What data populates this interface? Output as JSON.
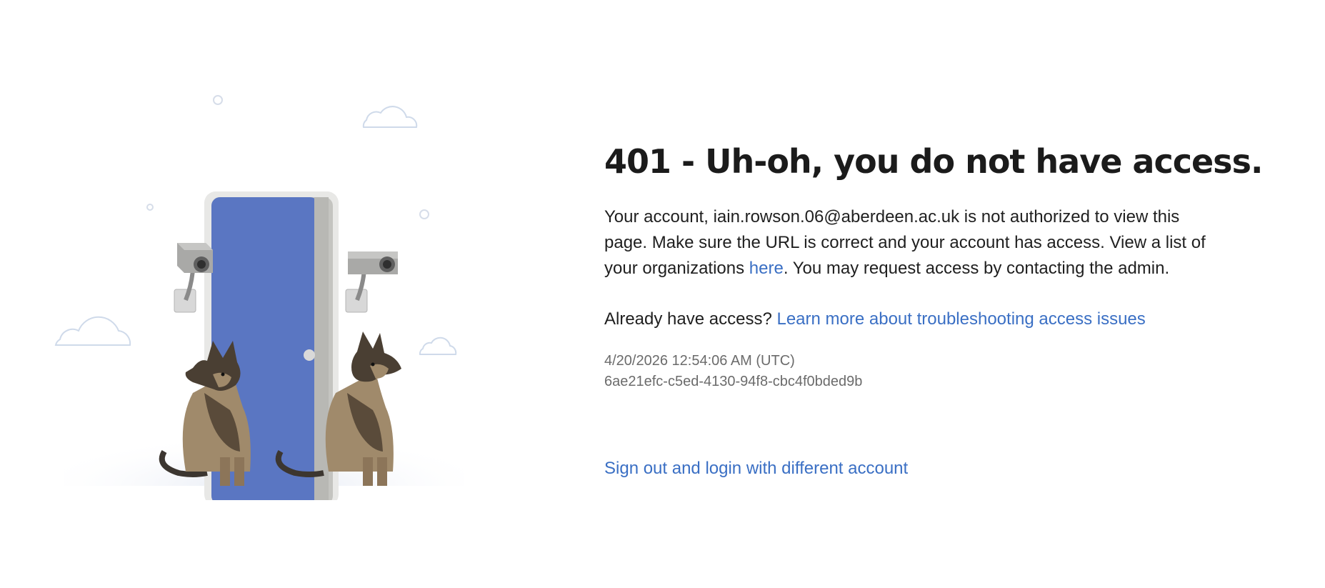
{
  "error": {
    "title": "401 - Uh-oh, you do not have access.",
    "message_before_email": "Your account, ",
    "account_email": "iain.rowson.06@aberdeen.ac.uk",
    "message_after_email": " is not authorized to view this page. Make sure the URL is correct and your account has access. View a list of your organizations ",
    "organizations_link": "here",
    "message_end": ". You may request access by contacting the admin.",
    "already_access_label": "Already have access? ",
    "troubleshoot_link": "Learn more about troubleshooting access issues",
    "timestamp": "4/20/2026 12:54:06 AM (UTC)",
    "correlation_id": "6ae21efc-c5ed-4130-94f8-cbc4f0bded9b",
    "signout_link": "Sign out and login with different account"
  },
  "colors": {
    "link": "#3a6fc4",
    "door": "#5a76c2",
    "text": "#1f1f1f",
    "muted": "#6b6b6b"
  },
  "illustration": {
    "icons": [
      "door-icon",
      "security-camera-icon",
      "guard-dog-icon",
      "cloud-icon"
    ]
  }
}
